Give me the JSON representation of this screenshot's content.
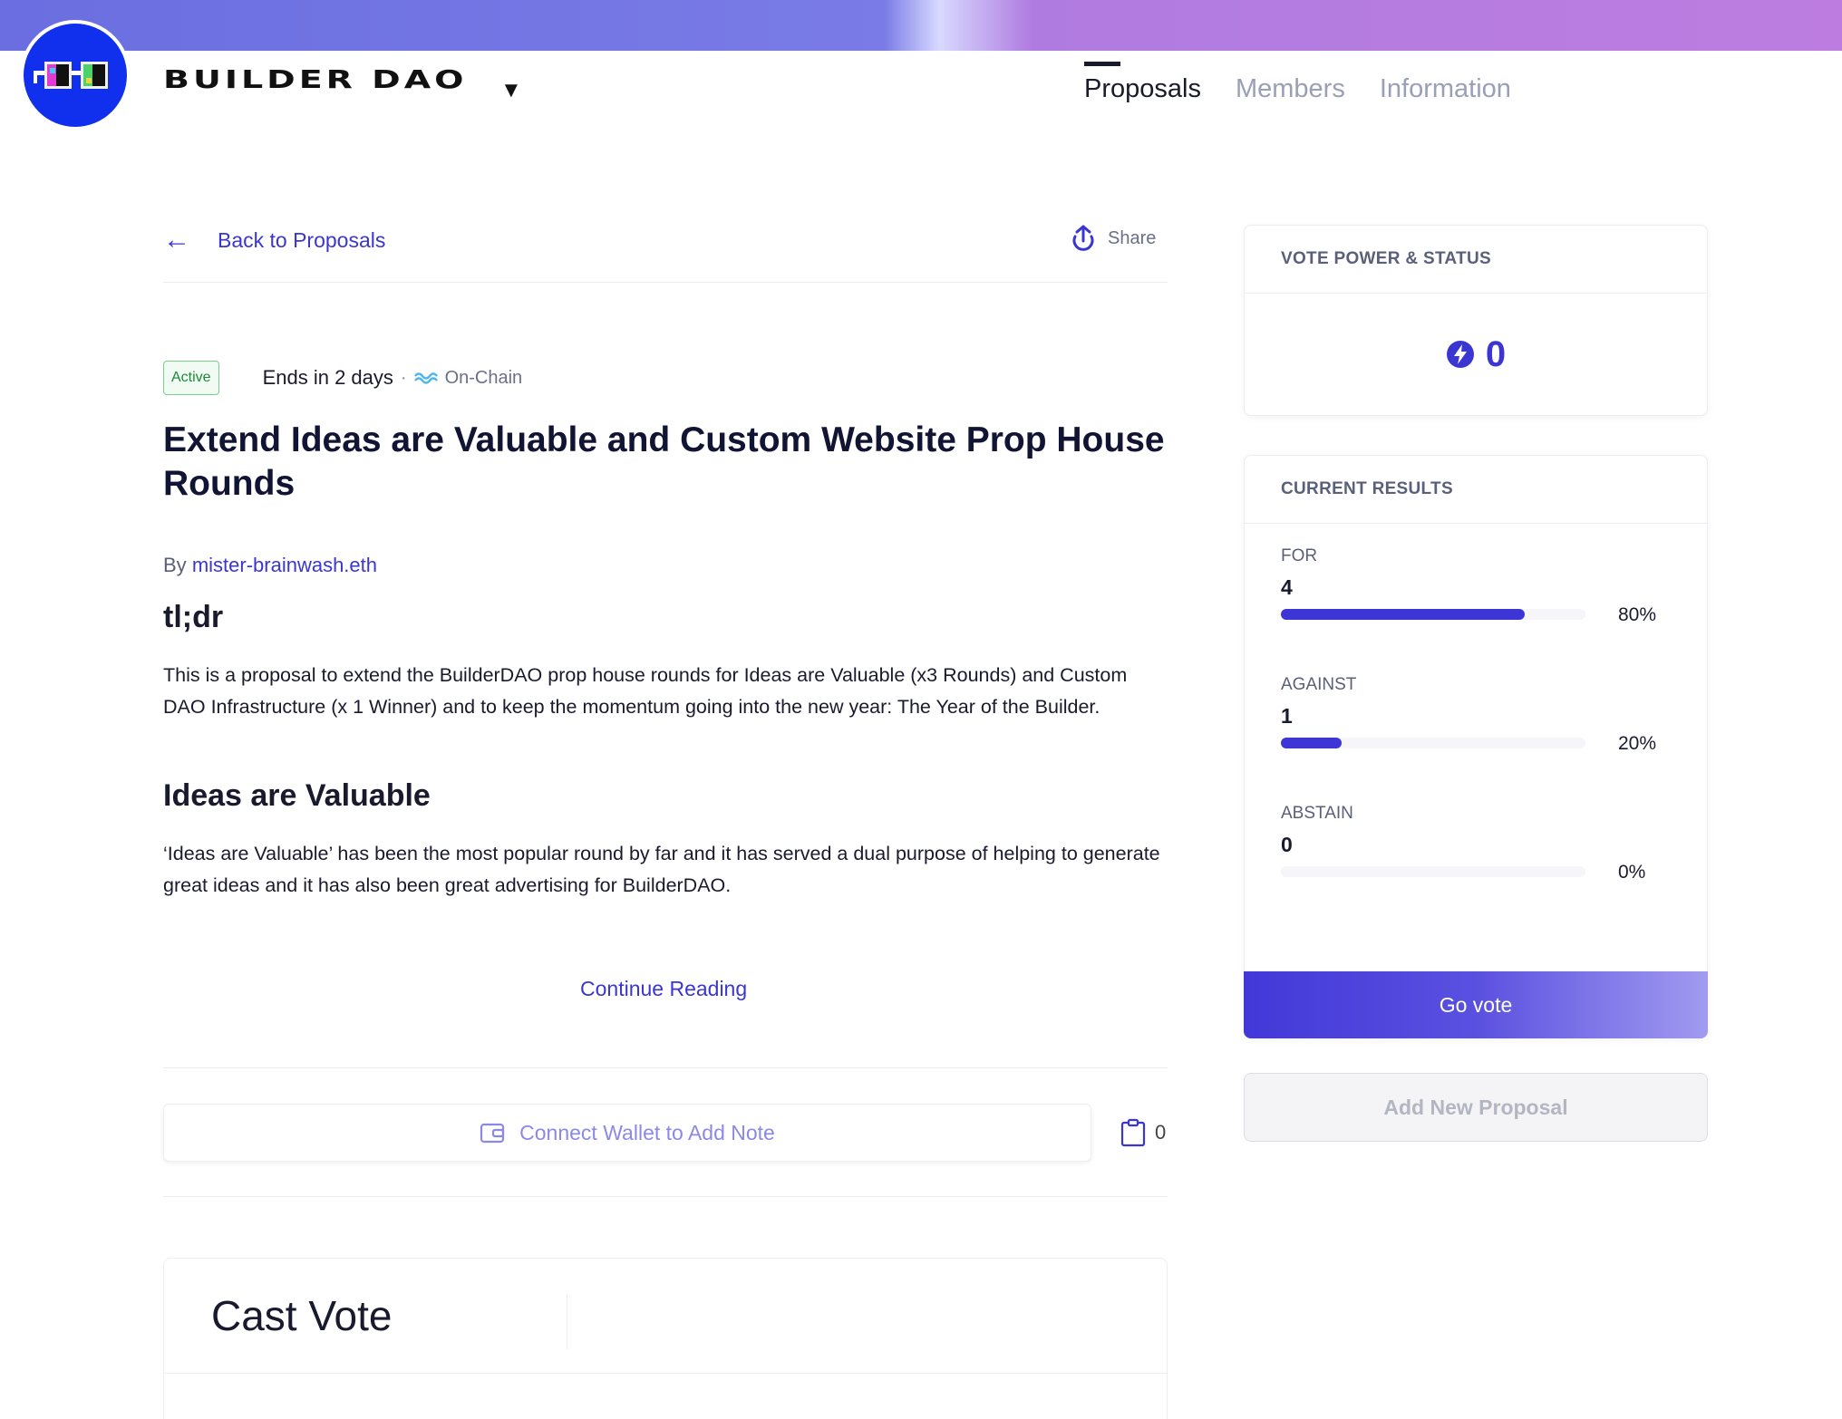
{
  "header": {
    "dao_name": "BUILDER DAO",
    "nav": [
      {
        "label": "Proposals",
        "active": true
      },
      {
        "label": "Members",
        "active": false
      },
      {
        "label": "Information",
        "active": false
      }
    ],
    "accent_color": "#3b35d1"
  },
  "toolbar": {
    "back_label": "Back to Proposals",
    "share_label": "Share"
  },
  "proposal": {
    "status": "Active",
    "ends": "Ends in 2 days",
    "separator": "·",
    "chain": "On-Chain",
    "title": "Extend Ideas are Valuable and Custom Website Prop House Rounds",
    "by_prefix": "By",
    "author": "mister-brainwash.eth",
    "heading_tldr": "tl;dr",
    "paragraph_tldr": "This is a proposal to extend the BuilderDAO prop house rounds for Ideas are Valuable (x3 Rounds) and Custom DAO Infrastructure (x 1 Winner) and to keep the momentum going into the new year: The Year of the Builder.",
    "heading_ideas": "Ideas are Valuable",
    "paragraph_ideas": "‘Ideas are Valuable’ has been the most popular round by far and it has served a dual purpose of helping to generate great ideas and it has also been great advertising for BuilderDAO.",
    "continue_label": "Continue Reading"
  },
  "notes": {
    "connect_label": "Connect Wallet to Add Note",
    "count": "0"
  },
  "cast_vote": {
    "title": "Cast Vote"
  },
  "vote_power": {
    "heading": "VOTE POWER & STATUS",
    "value": "0"
  },
  "results": {
    "heading": "CURRENT RESULTS",
    "items": [
      {
        "label": "FOR",
        "count": "4",
        "pct_label": "80%",
        "pct": 80
      },
      {
        "label": "AGAINST",
        "count": "1",
        "pct_label": "20%",
        "pct": 20
      },
      {
        "label": "ABSTAIN",
        "count": "0",
        "pct_label": "0%",
        "pct": 0
      }
    ]
  },
  "actions": {
    "go_vote_label": "Go vote",
    "add_proposal_label": "Add New Proposal"
  }
}
